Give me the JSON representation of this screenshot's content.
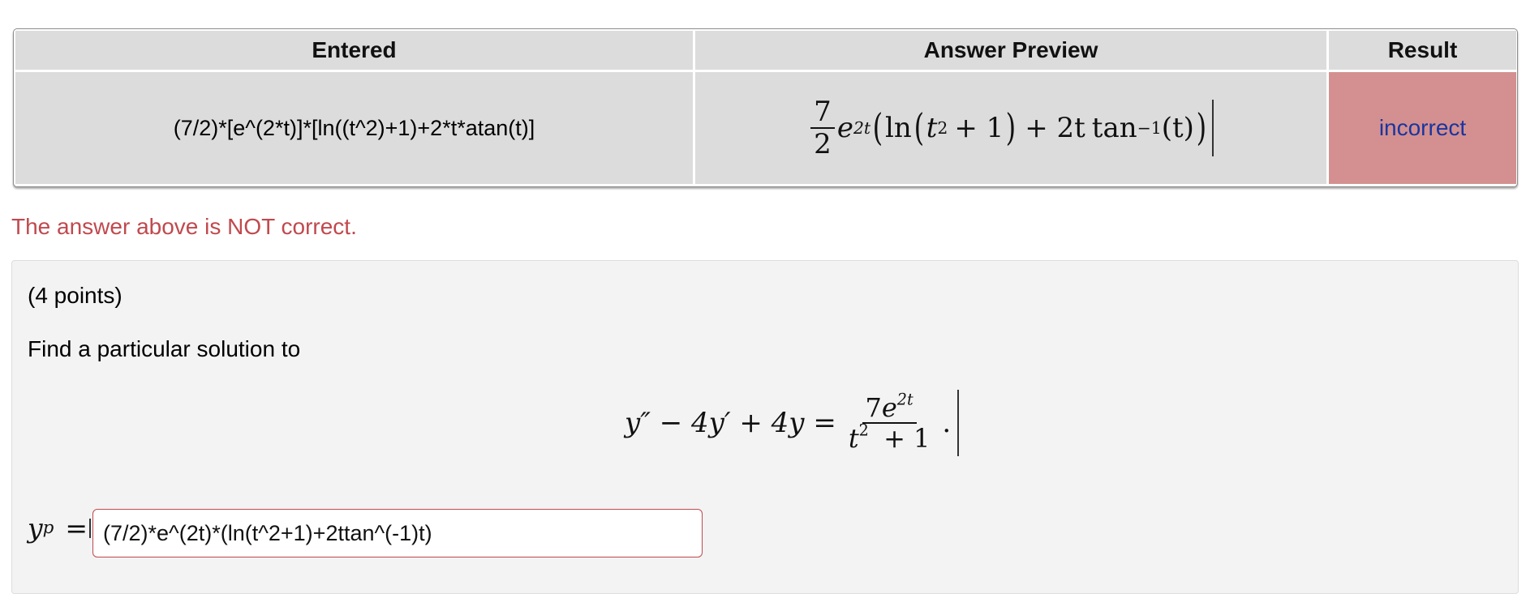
{
  "results_table": {
    "headers": {
      "entered": "Entered",
      "preview": "Answer Preview",
      "result": "Result"
    },
    "row": {
      "entered": "(7/2)*[e^(2*t)]*[ln((t^2)+1)+2*t*atan(t)]",
      "preview": {
        "coef_num": "7",
        "coef_den": "2",
        "base": "e",
        "exp": "2t",
        "open_outer": "(",
        "ln": "ln",
        "open_inner": "(",
        "t_var": "t",
        "t_exp": "2",
        "plus_one": "+ 1",
        "close_inner": ")",
        "plus_2t": "+ 2t",
        "tan": "tan",
        "tan_exp": "−1",
        "tan_arg": "(t)",
        "close_outer": ")"
      },
      "result": "incorrect",
      "result_bg": "#d49090",
      "result_color": "#1a35a0"
    }
  },
  "feedback": {
    "text": "The answer above is NOT correct.",
    "color": "#c0494e"
  },
  "problem": {
    "points": "(4 points)",
    "prompt": "Find a particular solution to",
    "equation": {
      "lhs": "y″ − 4y′ + 4y =",
      "rhs_num_coef": "7",
      "rhs_num_base": "e",
      "rhs_num_exp": "2t",
      "rhs_den_var": "t",
      "rhs_den_exp": "2",
      "rhs_den_rest": "+ 1",
      "terminator": "."
    },
    "answer": {
      "label_var": "y",
      "label_sub": "p",
      "label_eq": "=",
      "value": "(7/2)*e^(2t)*(ln(t^2+1)+2ttan^(-1)t)"
    }
  }
}
